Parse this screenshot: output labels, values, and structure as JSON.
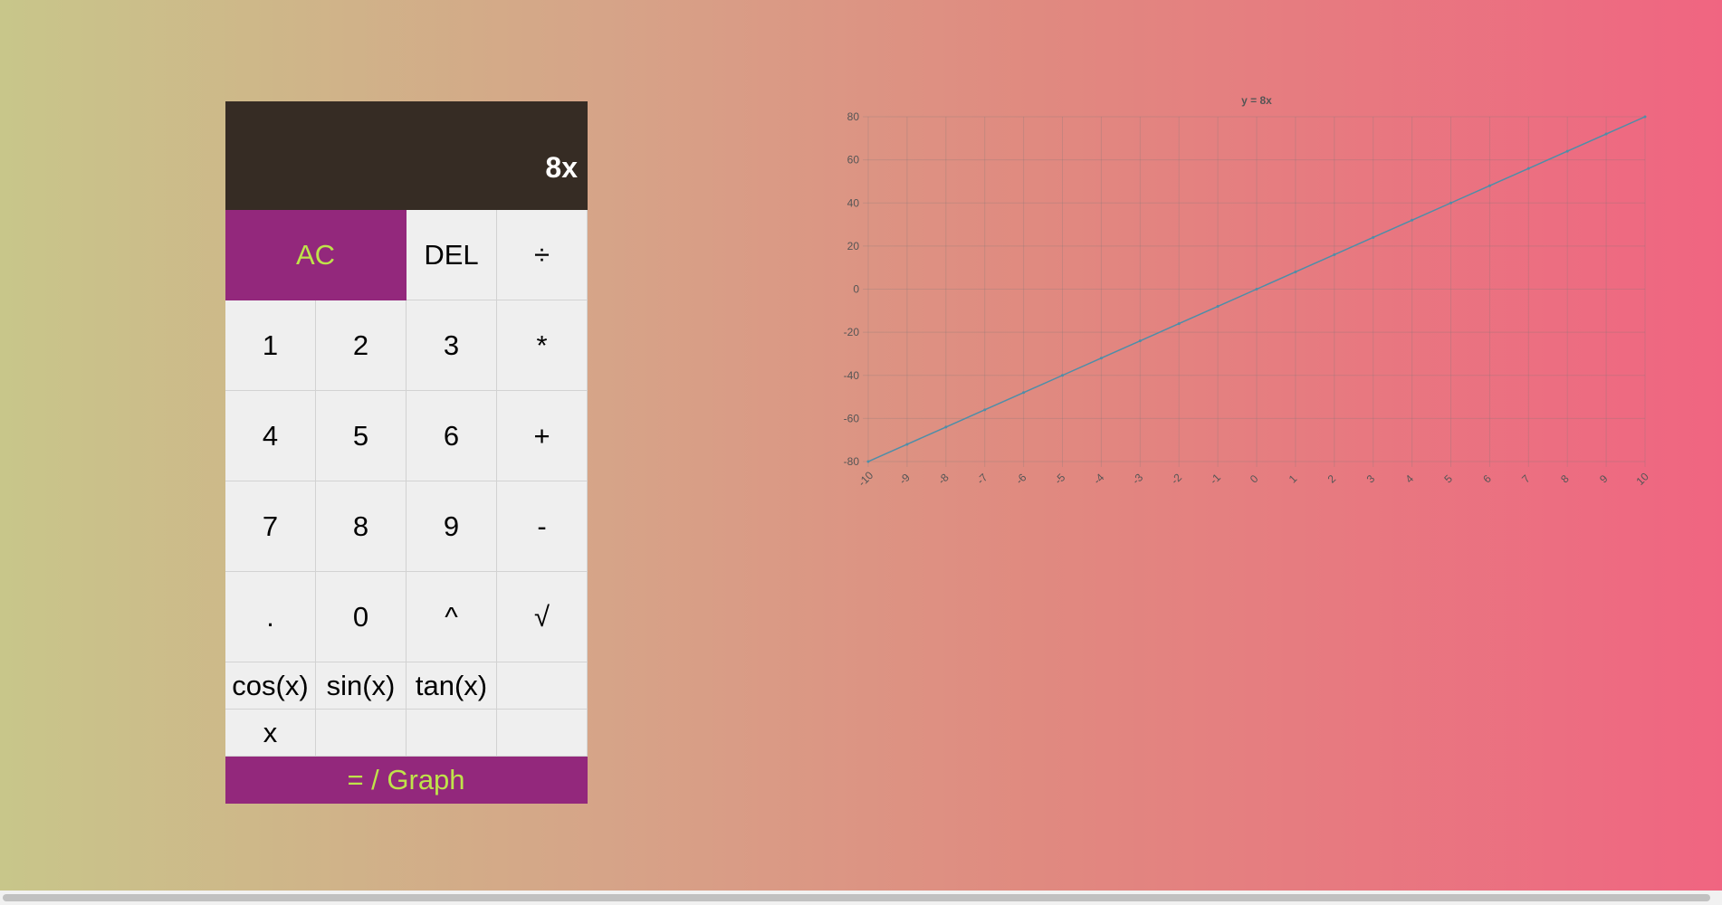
{
  "calculator": {
    "display": "8x",
    "keys": {
      "ac": "AC",
      "del": "DEL",
      "divide": "÷",
      "k1": "1",
      "k2": "2",
      "k3": "3",
      "multiply": "*",
      "k4": "4",
      "k5": "5",
      "k6": "6",
      "plus": "+",
      "k7": "7",
      "k8": "8",
      "k9": "9",
      "minus": "-",
      "dot": ".",
      "k0": "0",
      "power": "^",
      "sqrt": "√",
      "cos": "cos(x)",
      "sin": "sin(x)",
      "tan": "tan(x)",
      "x": "x",
      "equals_graph": "= / Graph"
    },
    "colors": {
      "accent": "#93287c",
      "accent_text": "#bfe34a",
      "display_bg": "#362c24"
    }
  },
  "chart_data": {
    "type": "line",
    "title": "y = 8x",
    "x": [
      -10,
      -9,
      -8,
      -7,
      -6,
      -5,
      -4,
      -3,
      -2,
      -1,
      0,
      1,
      2,
      3,
      4,
      5,
      6,
      7,
      8,
      9,
      10
    ],
    "series": [
      {
        "values": [
          -80,
          -72,
          -64,
          -56,
          -48,
          -40,
          -32,
          -24,
          -16,
          -8,
          0,
          8,
          16,
          24,
          32,
          40,
          48,
          56,
          64,
          72,
          80
        ],
        "color": "#4e8ea8"
      }
    ],
    "xlim": [
      -10,
      10
    ],
    "ylim": [
      -80,
      80
    ],
    "yticks": [
      -80,
      -60,
      -40,
      -20,
      0,
      20,
      40,
      60,
      80
    ],
    "grid": true
  }
}
